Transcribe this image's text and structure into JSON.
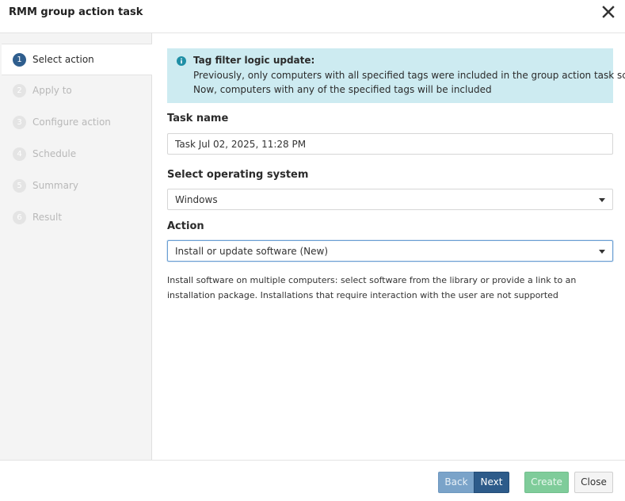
{
  "dialog": {
    "title": "RMM group action task"
  },
  "steps": [
    {
      "num": "1",
      "label": "Select action",
      "active": true
    },
    {
      "num": "2",
      "label": "Apply to",
      "active": false
    },
    {
      "num": "3",
      "label": "Configure action",
      "active": false
    },
    {
      "num": "4",
      "label": "Schedule",
      "active": false
    },
    {
      "num": "5",
      "label": "Summary",
      "active": false
    },
    {
      "num": "6",
      "label": "Result",
      "active": false
    }
  ],
  "info": {
    "icon": "info-circle-icon",
    "title": "Tag filter logic update:",
    "line1": "Previously, only computers with all specified tags were included in the group action task scope.",
    "line2": "Now, computers with any of the specified tags will be included"
  },
  "form": {
    "task_name_label": "Task name",
    "task_name_value": "Task Jul 02, 2025, 11:28 PM",
    "os_label": "Select operating system",
    "os_value": "Windows",
    "action_label": "Action",
    "action_value": "Install or update software (New)",
    "description": "Install software on multiple computers: select software from the library or provide a link to an installation package. Installations that require interaction with the user are not supported"
  },
  "footer": {
    "back_label": "Back",
    "next_label": "Next",
    "create_label": "Create",
    "close_label": "Close"
  },
  "colors": {
    "accent": "#2d5b8a",
    "info_bg": "#cdebf1",
    "create_green": "#7fcc9a"
  }
}
